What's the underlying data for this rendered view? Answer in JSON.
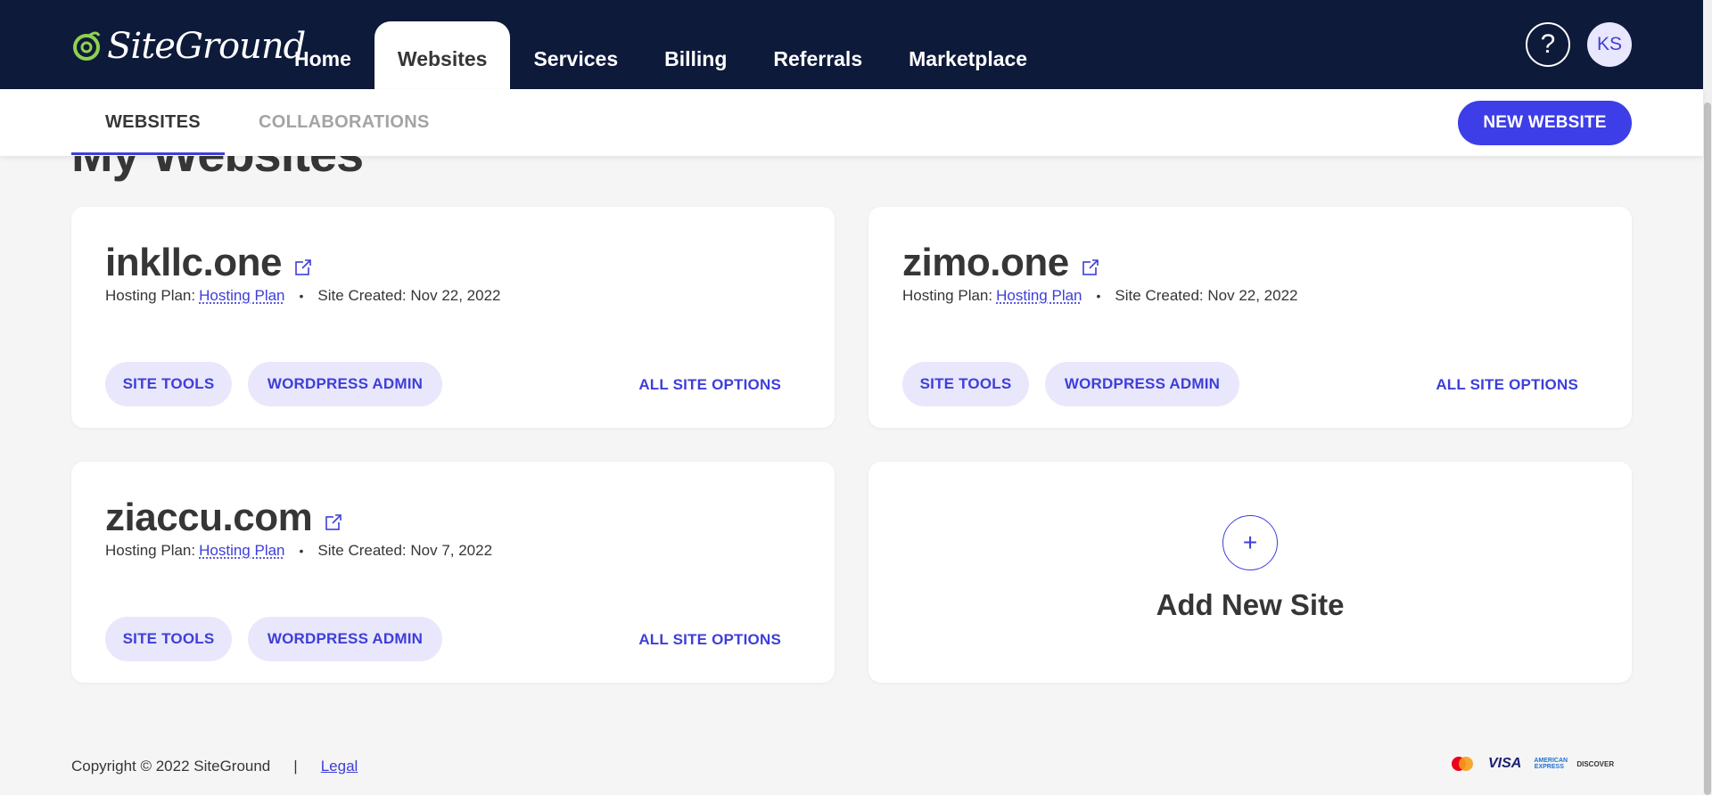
{
  "header": {
    "logo_text": "SiteGround",
    "tabs": [
      {
        "label": "Home",
        "active": false
      },
      {
        "label": "Websites",
        "active": true
      },
      {
        "label": "Services",
        "active": false
      },
      {
        "label": "Billing",
        "active": false
      },
      {
        "label": "Referrals",
        "active": false
      },
      {
        "label": "Marketplace",
        "active": false
      }
    ],
    "help_icon": "question-mark-icon",
    "avatar_initials": "KS"
  },
  "subnav": {
    "tabs": [
      {
        "label": "WEBSITES",
        "active": true
      },
      {
        "label": "COLLABORATIONS",
        "active": false
      }
    ],
    "new_website_label": "NEW WEBSITE"
  },
  "page_title": "My Websites",
  "sites": [
    {
      "name": "inkllc.one",
      "plan_label": "Hosting Plan:",
      "plan_link": "Hosting Plan",
      "created": "Site Created: Nov 22, 2022",
      "site_tools": "SITE TOOLS",
      "wp_admin": "WORDPRESS ADMIN",
      "all_options": "ALL SITE OPTIONS"
    },
    {
      "name": "zimo.one",
      "plan_label": "Hosting Plan:",
      "plan_link": "Hosting Plan",
      "created": "Site Created: Nov 22, 2022",
      "site_tools": "SITE TOOLS",
      "wp_admin": "WORDPRESS ADMIN",
      "all_options": "ALL SITE OPTIONS"
    },
    {
      "name": "ziaccu.com",
      "plan_label": "Hosting Plan:",
      "plan_link": "Hosting Plan",
      "created": "Site Created: Nov 7, 2022",
      "site_tools": "SITE TOOLS",
      "wp_admin": "WORDPRESS ADMIN",
      "all_options": "ALL SITE OPTIONS"
    }
  ],
  "add_site": {
    "plus": "+",
    "label": "Add New Site"
  },
  "footer": {
    "copyright": "Copyright © 2022 SiteGround",
    "separator": "|",
    "legal": "Legal",
    "payment_methods": [
      "mastercard-icon",
      "VISA",
      "AMERICAN EXPRESS",
      "DISCOVER"
    ]
  },
  "colors": {
    "navbar": "#0e1a3a",
    "accent": "#3e3ed9",
    "primary_button": "#3d3ee8",
    "pill_bg": "#e9e7fc",
    "page_bg": "#f5f5f5",
    "logo_green": "#8fd14f"
  }
}
